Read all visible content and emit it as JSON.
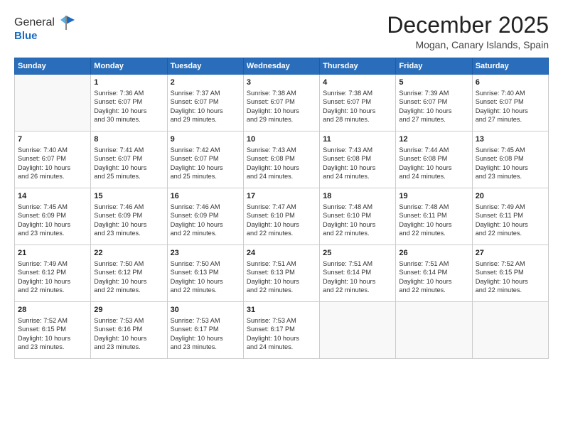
{
  "header": {
    "logo_line1": "General",
    "logo_line2": "Blue",
    "month": "December 2025",
    "location": "Mogan, Canary Islands, Spain"
  },
  "weekdays": [
    "Sunday",
    "Monday",
    "Tuesday",
    "Wednesday",
    "Thursday",
    "Friday",
    "Saturday"
  ],
  "weeks": [
    [
      {
        "day": "",
        "info": ""
      },
      {
        "day": "1",
        "info": "Sunrise: 7:36 AM\nSunset: 6:07 PM\nDaylight: 10 hours\nand 30 minutes."
      },
      {
        "day": "2",
        "info": "Sunrise: 7:37 AM\nSunset: 6:07 PM\nDaylight: 10 hours\nand 29 minutes."
      },
      {
        "day": "3",
        "info": "Sunrise: 7:38 AM\nSunset: 6:07 PM\nDaylight: 10 hours\nand 29 minutes."
      },
      {
        "day": "4",
        "info": "Sunrise: 7:38 AM\nSunset: 6:07 PM\nDaylight: 10 hours\nand 28 minutes."
      },
      {
        "day": "5",
        "info": "Sunrise: 7:39 AM\nSunset: 6:07 PM\nDaylight: 10 hours\nand 27 minutes."
      },
      {
        "day": "6",
        "info": "Sunrise: 7:40 AM\nSunset: 6:07 PM\nDaylight: 10 hours\nand 27 minutes."
      }
    ],
    [
      {
        "day": "7",
        "info": "Sunrise: 7:40 AM\nSunset: 6:07 PM\nDaylight: 10 hours\nand 26 minutes."
      },
      {
        "day": "8",
        "info": "Sunrise: 7:41 AM\nSunset: 6:07 PM\nDaylight: 10 hours\nand 25 minutes."
      },
      {
        "day": "9",
        "info": "Sunrise: 7:42 AM\nSunset: 6:07 PM\nDaylight: 10 hours\nand 25 minutes."
      },
      {
        "day": "10",
        "info": "Sunrise: 7:43 AM\nSunset: 6:08 PM\nDaylight: 10 hours\nand 24 minutes."
      },
      {
        "day": "11",
        "info": "Sunrise: 7:43 AM\nSunset: 6:08 PM\nDaylight: 10 hours\nand 24 minutes."
      },
      {
        "day": "12",
        "info": "Sunrise: 7:44 AM\nSunset: 6:08 PM\nDaylight: 10 hours\nand 24 minutes."
      },
      {
        "day": "13",
        "info": "Sunrise: 7:45 AM\nSunset: 6:08 PM\nDaylight: 10 hours\nand 23 minutes."
      }
    ],
    [
      {
        "day": "14",
        "info": "Sunrise: 7:45 AM\nSunset: 6:09 PM\nDaylight: 10 hours\nand 23 minutes."
      },
      {
        "day": "15",
        "info": "Sunrise: 7:46 AM\nSunset: 6:09 PM\nDaylight: 10 hours\nand 23 minutes."
      },
      {
        "day": "16",
        "info": "Sunrise: 7:46 AM\nSunset: 6:09 PM\nDaylight: 10 hours\nand 22 minutes."
      },
      {
        "day": "17",
        "info": "Sunrise: 7:47 AM\nSunset: 6:10 PM\nDaylight: 10 hours\nand 22 minutes."
      },
      {
        "day": "18",
        "info": "Sunrise: 7:48 AM\nSunset: 6:10 PM\nDaylight: 10 hours\nand 22 minutes."
      },
      {
        "day": "19",
        "info": "Sunrise: 7:48 AM\nSunset: 6:11 PM\nDaylight: 10 hours\nand 22 minutes."
      },
      {
        "day": "20",
        "info": "Sunrise: 7:49 AM\nSunset: 6:11 PM\nDaylight: 10 hours\nand 22 minutes."
      }
    ],
    [
      {
        "day": "21",
        "info": "Sunrise: 7:49 AM\nSunset: 6:12 PM\nDaylight: 10 hours\nand 22 minutes."
      },
      {
        "day": "22",
        "info": "Sunrise: 7:50 AM\nSunset: 6:12 PM\nDaylight: 10 hours\nand 22 minutes."
      },
      {
        "day": "23",
        "info": "Sunrise: 7:50 AM\nSunset: 6:13 PM\nDaylight: 10 hours\nand 22 minutes."
      },
      {
        "day": "24",
        "info": "Sunrise: 7:51 AM\nSunset: 6:13 PM\nDaylight: 10 hours\nand 22 minutes."
      },
      {
        "day": "25",
        "info": "Sunrise: 7:51 AM\nSunset: 6:14 PM\nDaylight: 10 hours\nand 22 minutes."
      },
      {
        "day": "26",
        "info": "Sunrise: 7:51 AM\nSunset: 6:14 PM\nDaylight: 10 hours\nand 22 minutes."
      },
      {
        "day": "27",
        "info": "Sunrise: 7:52 AM\nSunset: 6:15 PM\nDaylight: 10 hours\nand 22 minutes."
      }
    ],
    [
      {
        "day": "28",
        "info": "Sunrise: 7:52 AM\nSunset: 6:15 PM\nDaylight: 10 hours\nand 23 minutes."
      },
      {
        "day": "29",
        "info": "Sunrise: 7:53 AM\nSunset: 6:16 PM\nDaylight: 10 hours\nand 23 minutes."
      },
      {
        "day": "30",
        "info": "Sunrise: 7:53 AM\nSunset: 6:17 PM\nDaylight: 10 hours\nand 23 minutes."
      },
      {
        "day": "31",
        "info": "Sunrise: 7:53 AM\nSunset: 6:17 PM\nDaylight: 10 hours\nand 24 minutes."
      },
      {
        "day": "",
        "info": ""
      },
      {
        "day": "",
        "info": ""
      },
      {
        "day": "",
        "info": ""
      }
    ]
  ]
}
